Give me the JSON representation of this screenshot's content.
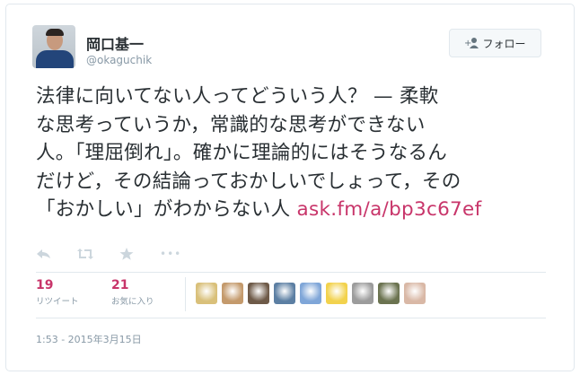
{
  "user": {
    "name": "岡口基一",
    "handle": "@okaguchik"
  },
  "follow_button": {
    "label": "フォロー"
  },
  "tweet": {
    "line1": "法律に向いてない人ってどういう人？ — 柔軟",
    "line2": "な思考っていうか，常識的な思考ができない",
    "line3": "人。「理屈倒れ」。確かに理論的にはそうなるん",
    "line4": "だけど，その結論っておかしいでしょって，その",
    "line5": "「おかしい」がわからない人 ",
    "link": "ask.fm/a/bp3c67ef"
  },
  "actions": {
    "more": "•••"
  },
  "stats": {
    "retweets_count": "19",
    "retweets_label": "リツイート",
    "favorites_count": "21",
    "favorites_label": "お気に入り"
  },
  "favoriters": [
    {
      "color": "#d9c07a"
    },
    {
      "color": "#c49a6c"
    },
    {
      "color": "#6e5a48"
    },
    {
      "color": "#5c7fa3"
    },
    {
      "color": "#7fa6d8"
    },
    {
      "color": "#f2d24d"
    },
    {
      "color": "#9c9c9c"
    },
    {
      "color": "#6b7350"
    },
    {
      "color": "#d9b8a6"
    }
  ],
  "timestamp": "1:53 - 2015年3月15日",
  "colors": {
    "link": "#c8356a",
    "muted": "#8899a6",
    "border": "#e1e8ed"
  }
}
